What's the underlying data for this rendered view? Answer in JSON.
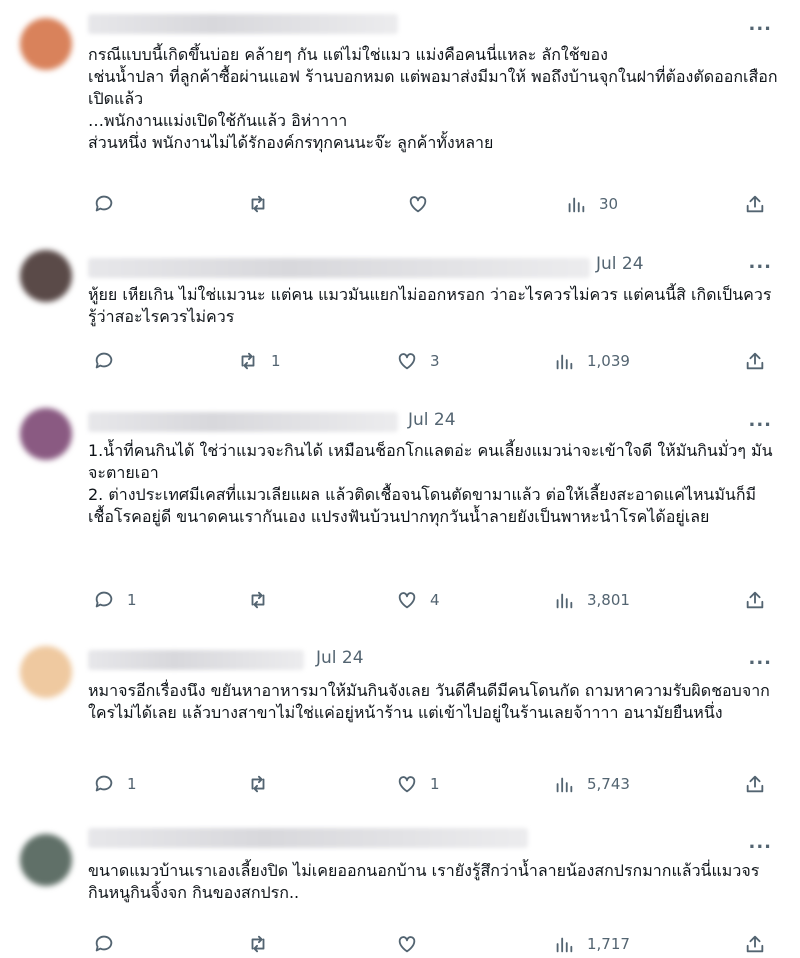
{
  "tweets": [
    {
      "avatar_color": "#d9825b",
      "date": "",
      "more": "...",
      "text": "กรณีแบบนี้เกิดขึ้นบ่อย คล้ายๆ กัน แต่ไม่ใช่แมว แม่งคือคนนี่แหละ ลักใช้ของ\nเช่นน้ำปลา ที่ลูกค้าซื้อผ่านแอฟ ร้านบอกหมด แต่พอมาส่งมีมาให้ พอถึงบ้านจุกในฝาที่ต้องตัดออกเสือกเปิดแล้ว\n…พนักงานแม่งเปิดใช้กันแล้ว อิห่าาาา\nส่วนหนึ่ง พนักงานไม่ได้รักองค์กรทุกคนนะจ๊ะ ลูกค้าทั้งหลาย",
      "replies": "",
      "reposts": "",
      "likes": "",
      "views": "30"
    },
    {
      "avatar_color": "#5a4a48",
      "date": "Jul 24",
      "more": "...",
      "text": "หู้ยย เหียเกิน ไม่ใช่แมวนะ แต่คน แมวมันแยกไม่ออกหรอก ว่าอะไรควรไม่ควร แต่คนนี้สิ เกิดเป็นควรรู้ว่าสอะไรควรไม่ควร",
      "replies": "",
      "reposts": "1",
      "likes": "3",
      "views": "1,039"
    },
    {
      "avatar_color": "#8a5a82",
      "date": "Jul 24",
      "more": "...",
      "text": "1.น้ำที่คนกินได้ ใช่ว่าแมวจะกินได้ เหมือนช็อกโกแลตอ่ะ คนเลี้ยงแมวน่าจะเข้าใจดี ให้มันกินมั่วๆ มันจะตายเอา\n2. ต่างประเทศมีเคสที่แมวเลียแผล แล้วติดเชื้อจนโดนตัดขามาแล้ว ต่อให้เลี้ยงสะอาดแค่ไหนมันก็มีเชื้อโรคอยู่ดี ขนาดคนเรากันเอง แปรงฟันบ้วนปากทุกวันน้ำลายยังเป็นพาหะนำโรคได้อยู่เลย",
      "replies": "1",
      "reposts": "",
      "likes": "4",
      "views": "3,801"
    },
    {
      "avatar_color": "#efc9a0",
      "date": "Jul 24",
      "more": "...",
      "text": "หมาจรอีกเรื่องนึง ขยันหาอาหารมาให้มันกินจังเลย วันดีคืนดีมีคนโดนกัด ถามหาความรับผิดชอบจากใครไม่ได้เลย แล้วบางสาขาไม่ใช่แค่อยู่หน้าร้าน แต่เข้าไปอยู่ในร้านเลยจ้าาาา อนามัยยืนหนึ่ง",
      "replies": "1",
      "reposts": "",
      "likes": "1",
      "views": "5,743"
    },
    {
      "avatar_color": "#607068",
      "date": "",
      "more": "...",
      "text": "ขนาดแมวบ้านเราเองเลี้ยงปิด ไม่เคยออกนอกบ้าน เรายังรู้สึกว่าน้ำลายน้องสกปรกมากแล้วนี่แมวจร กินหนูกินจิ้งจก กินของสกปรก..",
      "replies": "",
      "reposts": "",
      "likes": "",
      "views": "1,717"
    }
  ],
  "icons": {
    "reply": "reply-icon",
    "repost": "repost-icon",
    "like": "like-icon",
    "views": "views-icon",
    "share": "share-icon",
    "more": "more-icon"
  }
}
